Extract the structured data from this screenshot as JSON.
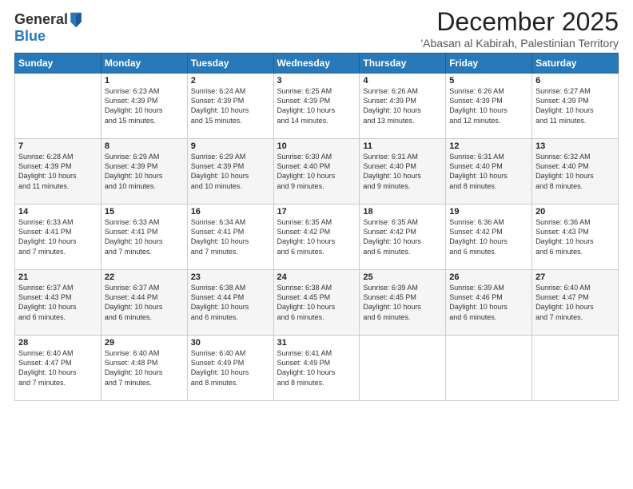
{
  "logo": {
    "general": "General",
    "blue": "Blue"
  },
  "header": {
    "month": "December 2025",
    "location": "'Abasan al Kabirah, Palestinian Territory"
  },
  "days_of_week": [
    "Sunday",
    "Monday",
    "Tuesday",
    "Wednesday",
    "Thursday",
    "Friday",
    "Saturday"
  ],
  "weeks": [
    [
      {
        "day": "",
        "info": ""
      },
      {
        "day": "1",
        "info": "Sunrise: 6:23 AM\nSunset: 4:39 PM\nDaylight: 10 hours\nand 15 minutes."
      },
      {
        "day": "2",
        "info": "Sunrise: 6:24 AM\nSunset: 4:39 PM\nDaylight: 10 hours\nand 15 minutes."
      },
      {
        "day": "3",
        "info": "Sunrise: 6:25 AM\nSunset: 4:39 PM\nDaylight: 10 hours\nand 14 minutes."
      },
      {
        "day": "4",
        "info": "Sunrise: 6:26 AM\nSunset: 4:39 PM\nDaylight: 10 hours\nand 13 minutes."
      },
      {
        "day": "5",
        "info": "Sunrise: 6:26 AM\nSunset: 4:39 PM\nDaylight: 10 hours\nand 12 minutes."
      },
      {
        "day": "6",
        "info": "Sunrise: 6:27 AM\nSunset: 4:39 PM\nDaylight: 10 hours\nand 11 minutes."
      }
    ],
    [
      {
        "day": "7",
        "info": "Sunrise: 6:28 AM\nSunset: 4:39 PM\nDaylight: 10 hours\nand 11 minutes."
      },
      {
        "day": "8",
        "info": "Sunrise: 6:29 AM\nSunset: 4:39 PM\nDaylight: 10 hours\nand 10 minutes."
      },
      {
        "day": "9",
        "info": "Sunrise: 6:29 AM\nSunset: 4:39 PM\nDaylight: 10 hours\nand 10 minutes."
      },
      {
        "day": "10",
        "info": "Sunrise: 6:30 AM\nSunset: 4:40 PM\nDaylight: 10 hours\nand 9 minutes."
      },
      {
        "day": "11",
        "info": "Sunrise: 6:31 AM\nSunset: 4:40 PM\nDaylight: 10 hours\nand 9 minutes."
      },
      {
        "day": "12",
        "info": "Sunrise: 6:31 AM\nSunset: 4:40 PM\nDaylight: 10 hours\nand 8 minutes."
      },
      {
        "day": "13",
        "info": "Sunrise: 6:32 AM\nSunset: 4:40 PM\nDaylight: 10 hours\nand 8 minutes."
      }
    ],
    [
      {
        "day": "14",
        "info": "Sunrise: 6:33 AM\nSunset: 4:41 PM\nDaylight: 10 hours\nand 7 minutes."
      },
      {
        "day": "15",
        "info": "Sunrise: 6:33 AM\nSunset: 4:41 PM\nDaylight: 10 hours\nand 7 minutes."
      },
      {
        "day": "16",
        "info": "Sunrise: 6:34 AM\nSunset: 4:41 PM\nDaylight: 10 hours\nand 7 minutes."
      },
      {
        "day": "17",
        "info": "Sunrise: 6:35 AM\nSunset: 4:42 PM\nDaylight: 10 hours\nand 6 minutes."
      },
      {
        "day": "18",
        "info": "Sunrise: 6:35 AM\nSunset: 4:42 PM\nDaylight: 10 hours\nand 6 minutes."
      },
      {
        "day": "19",
        "info": "Sunrise: 6:36 AM\nSunset: 4:42 PM\nDaylight: 10 hours\nand 6 minutes."
      },
      {
        "day": "20",
        "info": "Sunrise: 6:36 AM\nSunset: 4:43 PM\nDaylight: 10 hours\nand 6 minutes."
      }
    ],
    [
      {
        "day": "21",
        "info": "Sunrise: 6:37 AM\nSunset: 4:43 PM\nDaylight: 10 hours\nand 6 minutes."
      },
      {
        "day": "22",
        "info": "Sunrise: 6:37 AM\nSunset: 4:44 PM\nDaylight: 10 hours\nand 6 minutes."
      },
      {
        "day": "23",
        "info": "Sunrise: 6:38 AM\nSunset: 4:44 PM\nDaylight: 10 hours\nand 6 minutes."
      },
      {
        "day": "24",
        "info": "Sunrise: 6:38 AM\nSunset: 4:45 PM\nDaylight: 10 hours\nand 6 minutes."
      },
      {
        "day": "25",
        "info": "Sunrise: 6:39 AM\nSunset: 4:45 PM\nDaylight: 10 hours\nand 6 minutes."
      },
      {
        "day": "26",
        "info": "Sunrise: 6:39 AM\nSunset: 4:46 PM\nDaylight: 10 hours\nand 6 minutes."
      },
      {
        "day": "27",
        "info": "Sunrise: 6:40 AM\nSunset: 4:47 PM\nDaylight: 10 hours\nand 7 minutes."
      }
    ],
    [
      {
        "day": "28",
        "info": "Sunrise: 6:40 AM\nSunset: 4:47 PM\nDaylight: 10 hours\nand 7 minutes."
      },
      {
        "day": "29",
        "info": "Sunrise: 6:40 AM\nSunset: 4:48 PM\nDaylight: 10 hours\nand 7 minutes."
      },
      {
        "day": "30",
        "info": "Sunrise: 6:40 AM\nSunset: 4:49 PM\nDaylight: 10 hours\nand 8 minutes."
      },
      {
        "day": "31",
        "info": "Sunrise: 6:41 AM\nSunset: 4:49 PM\nDaylight: 10 hours\nand 8 minutes."
      },
      {
        "day": "",
        "info": ""
      },
      {
        "day": "",
        "info": ""
      },
      {
        "day": "",
        "info": ""
      }
    ]
  ]
}
